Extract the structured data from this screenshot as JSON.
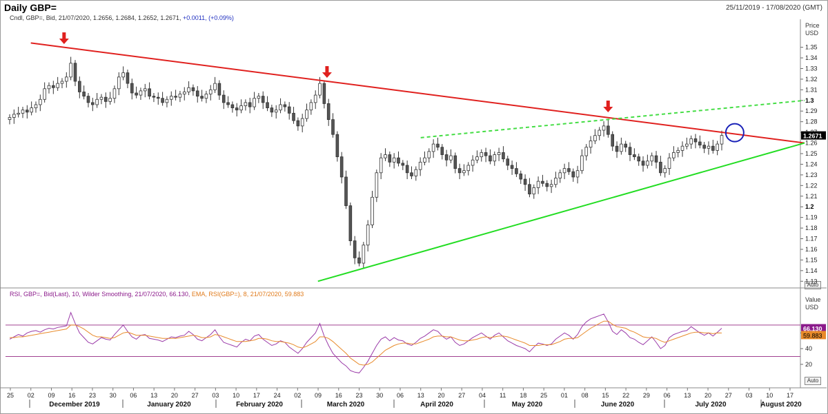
{
  "header": {
    "title": "Daily GBP=",
    "date_range": "25/11/2019 - 17/08/2020 (GMT)"
  },
  "legend": {
    "main": "Cndl, GBP=, Bid, 21/07/2020, 1.2656, 1.2684, 1.2652, 1.2671,",
    "change": "+0.0011, (+0.09%)"
  },
  "rsi_legend": {
    "rsi": "RSI, GBP=, Bid(Last), 10, Wilder Smoothing, 21/07/2020, 66.130,",
    "ema": "EMA, RSI(GBP=), 8, 21/07/2020, 59.883"
  },
  "price_axis": {
    "title_line1": "Price",
    "title_line2": "USD",
    "auto_label": "Auto"
  },
  "rsi_axis": {
    "title_line1": "Value",
    "title_line2": "USD",
    "auto_label": "Auto"
  },
  "colors": {
    "resistance": "#e0201e",
    "support": "#22dd22",
    "upper_dashed": "#44dd44",
    "marker": "#e0201e",
    "circle": "#1a22b8",
    "rsi": "#9a3aa8",
    "ema": "#e88a2a",
    "bands": "#a04090",
    "candle_down": "#555555",
    "candle_up": "#ffffff"
  },
  "chart_data": [
    {
      "type": "candlestick",
      "title": "Daily GBP=",
      "ylabel": "Price USD",
      "ylim": [
        1.125,
        1.375
      ],
      "y_ticks": [
        "1.35",
        "1.34",
        "1.33",
        "1.32",
        "1.31",
        "1.3",
        "1.29",
        "1.28",
        "1.27",
        "1.26",
        "1.25",
        "1.24",
        "1.23",
        "1.22",
        "1.21",
        "1.2",
        "1.19",
        "1.18",
        "1.17",
        "1.16",
        "1.15",
        "1.14",
        "1.13"
      ],
      "y_ticks_bold": [
        "1.3",
        "1.2"
      ],
      "last_price_label": "1.2671",
      "x_day_labels": [
        "25",
        "02",
        "09",
        "16",
        "23",
        "30",
        "06",
        "13",
        "20",
        "27",
        "03",
        "10",
        "17",
        "24",
        "02",
        "09",
        "16",
        "23",
        "30",
        "06",
        "13",
        "20",
        "27",
        "04",
        "11",
        "18",
        "25",
        "01",
        "08",
        "15",
        "22",
        "29",
        "06",
        "13",
        "20",
        "27",
        "03",
        "10",
        "17"
      ],
      "x_month_labels": [
        "December 2019",
        "January 2020",
        "February 2020",
        "March 2020",
        "April 2020",
        "May 2020",
        "June 2020",
        "July 2020",
        "August 2020"
      ],
      "closes": [
        1.284,
        1.287,
        1.288,
        1.291,
        1.289,
        1.293,
        1.296,
        1.301,
        1.311,
        1.314,
        1.312,
        1.316,
        1.318,
        1.322,
        1.335,
        1.318,
        1.308,
        1.304,
        1.298,
        1.296,
        1.301,
        1.303,
        1.299,
        1.302,
        1.311,
        1.322,
        1.326,
        1.316,
        1.307,
        1.305,
        1.309,
        1.311,
        1.304,
        1.303,
        1.302,
        1.298,
        1.301,
        1.304,
        1.303,
        1.306,
        1.308,
        1.312,
        1.309,
        1.304,
        1.302,
        1.306,
        1.31,
        1.316,
        1.305,
        1.298,
        1.296,
        1.293,
        1.291,
        1.295,
        1.298,
        1.294,
        1.302,
        1.304,
        1.298,
        1.293,
        1.289,
        1.291,
        1.296,
        1.294,
        1.288,
        1.281,
        1.276,
        1.283,
        1.291,
        1.298,
        1.305,
        1.316,
        1.297,
        1.282,
        1.268,
        1.247,
        1.228,
        1.201,
        1.168,
        1.152,
        1.147,
        1.164,
        1.183,
        1.209,
        1.232,
        1.246,
        1.249,
        1.242,
        1.246,
        1.241,
        1.239,
        1.232,
        1.229,
        1.235,
        1.242,
        1.246,
        1.252,
        1.259,
        1.256,
        1.249,
        1.244,
        1.248,
        1.236,
        1.232,
        1.234,
        1.239,
        1.244,
        1.247,
        1.251,
        1.248,
        1.243,
        1.249,
        1.251,
        1.245,
        1.239,
        1.236,
        1.231,
        1.226,
        1.221,
        1.212,
        1.218,
        1.224,
        1.222,
        1.219,
        1.221,
        1.227,
        1.232,
        1.236,
        1.233,
        1.228,
        1.234,
        1.248,
        1.256,
        1.262,
        1.267,
        1.272,
        1.276,
        1.268,
        1.257,
        1.252,
        1.259,
        1.256,
        1.249,
        1.247,
        1.243,
        1.239,
        1.243,
        1.248,
        1.242,
        1.232,
        1.236,
        1.246,
        1.251,
        1.253,
        1.257,
        1.259,
        1.264,
        1.261,
        1.258,
        1.255,
        1.257,
        1.253,
        1.259,
        1.2671
      ],
      "trendlines": [
        {
          "name": "resistance",
          "points": [
            [
              "2019-12-02",
              1.354
            ],
            [
              "2020-08-14",
              1.26
            ]
          ]
        },
        {
          "name": "support",
          "points": [
            [
              "2020-03-06",
              1.13
            ],
            [
              "2020-08-14",
              1.26
            ]
          ]
        },
        {
          "name": "upper-dashed",
          "dashed": true,
          "points": [
            [
              "2020-04-09",
              1.265
            ],
            [
              "2020-08-14",
              1.3
            ]
          ]
        }
      ],
      "markers": [
        "2019-12-13",
        "2020-03-09",
        "2020-06-10"
      ],
      "highlight": {
        "date": "2020-07-21",
        "price": 1.2671
      }
    },
    {
      "type": "line",
      "title": "RSI",
      "ylabel": "Value USD",
      "ylim": [
        5,
        105
      ],
      "y_ticks": [
        "60",
        "40",
        "20"
      ],
      "bands": [
        70,
        30
      ],
      "series": [
        {
          "name": "RSI",
          "values": [
            52,
            55,
            58,
            56,
            60,
            62,
            63,
            61,
            64,
            66,
            65,
            67,
            68,
            69,
            86,
            72,
            60,
            54,
            48,
            46,
            50,
            54,
            52,
            51,
            58,
            64,
            70,
            62,
            55,
            52,
            57,
            58,
            53,
            52,
            51,
            49,
            52,
            55,
            54,
            56,
            57,
            62,
            58,
            52,
            50,
            54,
            58,
            64,
            55,
            48,
            46,
            44,
            42,
            48,
            52,
            50,
            56,
            58,
            52,
            48,
            44,
            46,
            50,
            48,
            42,
            38,
            34,
            40,
            48,
            54,
            60,
            72,
            56,
            44,
            34,
            28,
            22,
            18,
            12,
            10,
            9,
            16,
            24,
            34,
            44,
            52,
            55,
            50,
            54,
            51,
            50,
            46,
            44,
            48,
            53,
            56,
            60,
            64,
            62,
            56,
            52,
            55,
            48,
            44,
            46,
            50,
            54,
            57,
            60,
            56,
            52,
            57,
            60,
            55,
            50,
            47,
            44,
            42,
            40,
            36,
            42,
            47,
            46,
            44,
            46,
            52,
            56,
            60,
            57,
            52,
            58,
            68,
            74,
            78,
            80,
            82,
            84,
            74,
            62,
            58,
            64,
            60,
            54,
            52,
            48,
            45,
            50,
            55,
            48,
            40,
            44,
            54,
            58,
            60,
            62,
            63,
            68,
            64,
            60,
            57,
            60,
            56,
            61,
            66
          ]
        },
        {
          "name": "EMA",
          "values": [
            54,
            54,
            55,
            55,
            56,
            57,
            58,
            59,
            60,
            61,
            62,
            63,
            64,
            65,
            70,
            70,
            68,
            65,
            61,
            57,
            55,
            55,
            54,
            53,
            54,
            57,
            60,
            61,
            59,
            57,
            57,
            57,
            56,
            55,
            54,
            53,
            53,
            53,
            53,
            54,
            55,
            56,
            57,
            56,
            54,
            54,
            55,
            58,
            57,
            55,
            53,
            51,
            49,
            49,
            49,
            50,
            51,
            53,
            53,
            52,
            50,
            49,
            49,
            48,
            47,
            45,
            42,
            41,
            43,
            46,
            49,
            55,
            55,
            53,
            49,
            44,
            39,
            34,
            28,
            24,
            20,
            19,
            20,
            23,
            28,
            33,
            38,
            41,
            44,
            46,
            47,
            47,
            46,
            46,
            48,
            50,
            52,
            55,
            56,
            56,
            55,
            55,
            53,
            51,
            50,
            50,
            51,
            52,
            54,
            55,
            54,
            55,
            56,
            56,
            55,
            53,
            51,
            49,
            47,
            44,
            44,
            44,
            45,
            45,
            45,
            47,
            49,
            52,
            53,
            53,
            54,
            58,
            62,
            66,
            69,
            72,
            75,
            75,
            71,
            68,
            67,
            66,
            63,
            61,
            58,
            55,
            54,
            54,
            53,
            50,
            48,
            50,
            52,
            54,
            56,
            58,
            60,
            61,
            61,
            60,
            60,
            59,
            60,
            59.883
          ]
        }
      ]
    }
  ]
}
